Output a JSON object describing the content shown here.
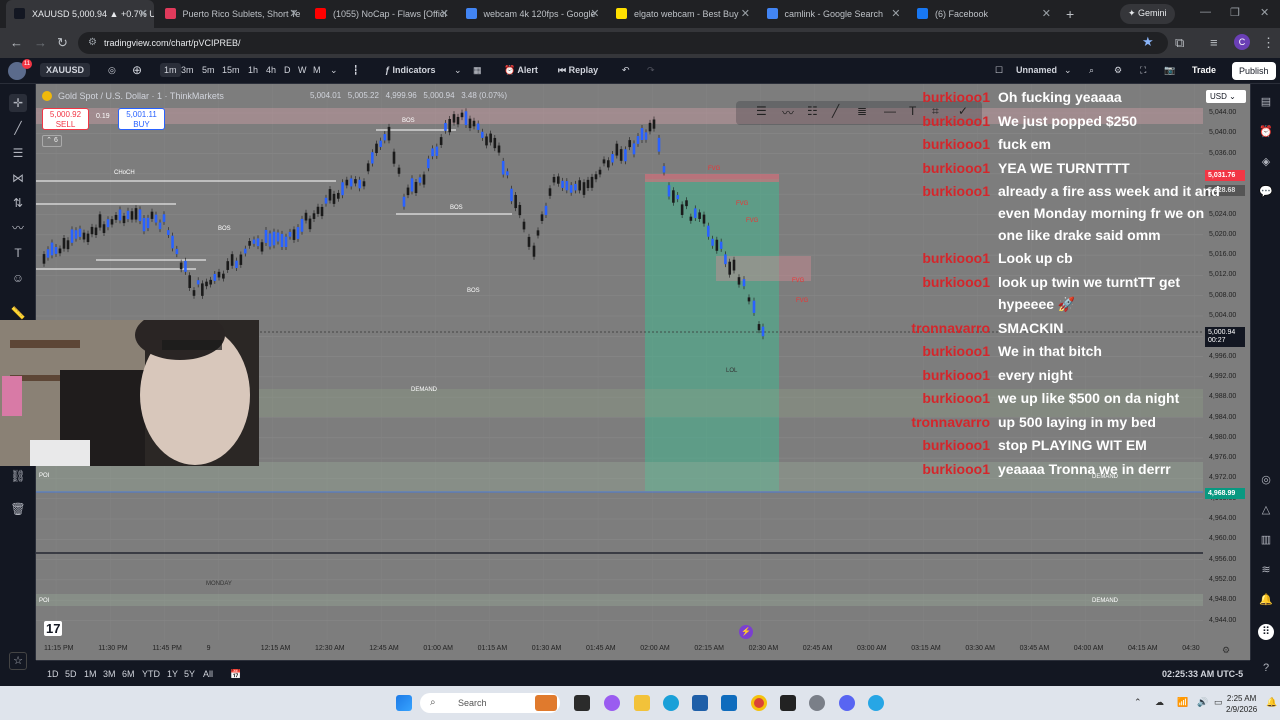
{
  "browser": {
    "tabs": [
      {
        "title": "XAUUSD 5,000.94 ▲ +0.7% U",
        "color": "#131722"
      },
      {
        "title": "Puerto Rico Sublets, Short Te",
        "color": "#e03a5b"
      },
      {
        "title": "(1055) NoCap - Flaws [Offici",
        "color": "#ff0000"
      },
      {
        "title": "webcam 4k 120fps - Google",
        "color": "#4285f4"
      },
      {
        "title": "elgato webcam - Best Buy",
        "color": "#ffe000"
      },
      {
        "title": "camlink - Google Search",
        "color": "#4285f4"
      },
      {
        "title": "(6) Facebook",
        "color": "#1877f2"
      }
    ],
    "gemini_label": "Gemini",
    "url": "tradingview.com/chart/pVCIPREB/",
    "profile_initial": "C"
  },
  "toolbar": {
    "symbol": "XAUUSD",
    "badge": "11",
    "intervals": [
      "1m",
      "3m",
      "5m",
      "15m",
      "1h",
      "4h",
      "D",
      "W",
      "M"
    ],
    "indicators_label": "Indicators",
    "alert_label": "Alert",
    "replay_label": "Replay",
    "layout_name": "Unnamed",
    "trade_label": "Trade",
    "publish_label": "Publish"
  },
  "legend": {
    "title": "Gold Spot / U.S. Dollar · 1 · ThinkMarkets",
    "ohlc": "5,004.01   5,005.22   4,999.96   5,000.94   3.48 (0.07%)",
    "sell_price": "5,000.92",
    "sell_label": "SELL",
    "spread": "0.19",
    "buy_price": "5,001.11",
    "buy_label": "BUY",
    "collapse": "6"
  },
  "price_axis": {
    "currency": "USD",
    "ticks": [
      "5,044.00",
      "5,040.00",
      "5,036.00",
      "5,032.00",
      "5,028.00",
      "5,024.00",
      "5,020.00",
      "5,016.00",
      "5,012.00",
      "5,008.00",
      "5,004.00",
      "5,000.00",
      "4,996.00",
      "4,992.00",
      "4,988.00",
      "4,984.00",
      "4,980.00",
      "4,976.00",
      "4,972.00",
      "4,968.00",
      "4,964.00",
      "4,960.00",
      "4,956.00",
      "4,952.00",
      "4,948.00",
      "4,944.00"
    ],
    "red_tag": "5,031.76",
    "gray_tag": "5,028.68",
    "current_price": "5,000.94",
    "countdown": "00:27",
    "green_tag": "4,968.99"
  },
  "time_axis": [
    "11:15 PM",
    "11:30 PM",
    "11:45 PM",
    "9",
    "12:15 AM",
    "12:30 AM",
    "12:45 AM",
    "01:00 AM",
    "01:15 AM",
    "01:30 AM",
    "01:45 AM",
    "02:00 AM",
    "02:15 AM",
    "02:30 AM",
    "02:45 AM",
    "03:00 AM",
    "03:15 AM",
    "03:30 AM",
    "03:45 AM",
    "04:00 AM",
    "04:15 AM",
    "04:30"
  ],
  "annotations": {
    "bos": "BOS",
    "choch": "CHoCH",
    "demand": "DEMAND",
    "poi": "POI",
    "monday": "MONDAY",
    "lol": "LOL",
    "fvg": "FVG"
  },
  "chat": [
    {
      "user": "burkiooo1",
      "text": "Oh fucking yeaaaa"
    },
    {
      "user": "burkiooo1",
      "text": "We just popped $250"
    },
    {
      "user": "burkiooo1",
      "text": "fuck em"
    },
    {
      "user": "burkiooo1",
      "text": "YEA WE TURNTTTT"
    },
    {
      "user": "burkiooo1",
      "text": "already a fire ass week and it and even Monday morning fr we on one like drake said omm"
    },
    {
      "user": "burkiooo1",
      "text": "Look up cb"
    },
    {
      "user": "burkiooo1",
      "text": "look up twin we turntTT get hypeeee 🚀"
    },
    {
      "user": "tronnavarro",
      "text": "SMACKIN"
    },
    {
      "user": "burkiooo1",
      "text": "We in that bitch"
    },
    {
      "user": "burkiooo1",
      "text": "every night"
    },
    {
      "user": "burkiooo1",
      "text": "we up like $500 on da night"
    },
    {
      "user": "tronnavarro",
      "text": "up 500 laying in my bed"
    },
    {
      "user": "burkiooo1",
      "text": "stop PLAYING WIT EM"
    },
    {
      "user": "burkiooo1",
      "text": "yeaaaa Tronna we in derrr"
    }
  ],
  "bottom": {
    "ranges": [
      "1D",
      "5D",
      "1M",
      "3M",
      "6M",
      "YTD",
      "1Y",
      "5Y",
      "All"
    ],
    "time": "02:25:33 AM UTC-5"
  },
  "taskbar": {
    "search_label": "Search",
    "time": "2:25 AM",
    "date": "2/9/2026"
  }
}
